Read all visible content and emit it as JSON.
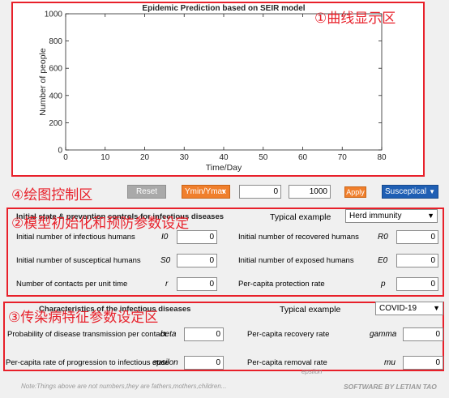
{
  "chart_data": {
    "type": "line",
    "title": "Epidemic Prediction based on SEIR model",
    "xlabel": "Time/Day",
    "ylabel": "Number of people",
    "xlim": [
      0,
      80
    ],
    "ylim": [
      0,
      1000
    ],
    "x_ticks": [
      "0",
      "10",
      "20",
      "30",
      "40",
      "50",
      "60",
      "70",
      "80"
    ],
    "y_ticks": [
      "0",
      "200",
      "400",
      "600",
      "800",
      "1000"
    ],
    "series": []
  },
  "zones": {
    "z1": "①曲线显示区",
    "z2": "②模型初始化和预防参数设定",
    "z3": "③传染病特征参数设定区",
    "z4": "④绘图控制区"
  },
  "controls": {
    "reset": "Reset",
    "ymin_ymax": "Ymin/Ymax",
    "ymin_value": "0",
    "ymax_value": "1000",
    "apply": "Apply",
    "series_select": "Susceptical"
  },
  "init_panel": {
    "title": "Initial state & prevention controls for infectious diseases",
    "typical_label": "Typical example",
    "typical_value": "Herd immunity",
    "fields": [
      {
        "label": "Initial number of infectious humans",
        "sym": "I0",
        "value": "0"
      },
      {
        "label": "Initial number of recovered humans",
        "sym": "R0",
        "value": "0"
      },
      {
        "label": "Initial number of susceptical humans",
        "sym": "S0",
        "value": "0"
      },
      {
        "label": "Initial number of exposed humans",
        "sym": "E0",
        "value": "0"
      },
      {
        "label": "Number of contacts per unit time",
        "sym": "r",
        "value": "0"
      },
      {
        "label": "Per-capita protection rate",
        "sym": "p",
        "value": "0"
      }
    ]
  },
  "char_panel": {
    "title": "Characteristics of the infectious diseases",
    "typical_label": "Typical example",
    "typical_value": "COVID-19",
    "fields": [
      {
        "label": "Probability of disease transmission per contact",
        "sym": "beta",
        "value": "0"
      },
      {
        "label": "Per-capita recovery rate",
        "sym": "gamma",
        "value": "0"
      },
      {
        "label": "Per-capita rate of progression to infectious state",
        "sym": "epsilon",
        "value": "0"
      },
      {
        "label": "Per-capita removal rate",
        "sym": "mu",
        "value": "0"
      }
    ],
    "stray_sym": "epsilon"
  },
  "footer": {
    "note": "Note:Things above are not numbers,they are fathers,mothers,children...",
    "credit": "SOFTWARE BY LETIAN TAO"
  },
  "colors": {
    "accent_orange": "#f07f2c",
    "accent_blue": "#1f5fb4",
    "zone_red": "#e8202a"
  }
}
